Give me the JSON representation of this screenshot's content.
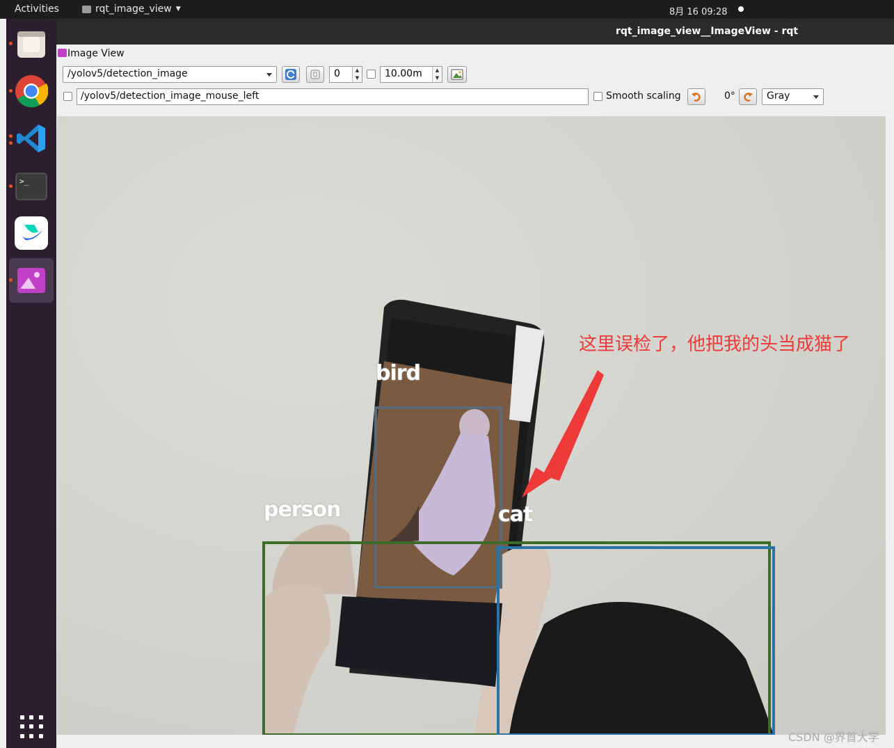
{
  "topbar": {
    "activities": "Activities",
    "app_name": "rqt_image_view",
    "clock": "8月 16  09:28"
  },
  "window": {
    "title": "rqt_image_view__ImageView - rqt",
    "panel_title": "Image View"
  },
  "toolbar": {
    "topic": "/yolov5/detection_image",
    "spin_value": "0",
    "duration": "10.00m",
    "mouse_topic": "/yolov5/detection_image_mouse_left",
    "smooth_scaling_label": "Smooth scaling",
    "rotation": "0°",
    "color_scheme": "Gray"
  },
  "image": {
    "detections": [
      {
        "label": "bird",
        "color": "#5c6a78"
      },
      {
        "label": "person",
        "color": "#3e6a2a"
      },
      {
        "label": "cat",
        "color": "#2a73a6"
      }
    ],
    "annotation": "这里误检了，他把我的头当成猫了",
    "annotation_color": "#ef3a3a"
  },
  "dock": {
    "icons": [
      "files-icon",
      "chrome-icon",
      "vscode-icon",
      "terminal-icon",
      "feishu-icon",
      "image-viewer-icon",
      "app-grid-icon"
    ]
  },
  "watermark": "CSDN @界首大学"
}
